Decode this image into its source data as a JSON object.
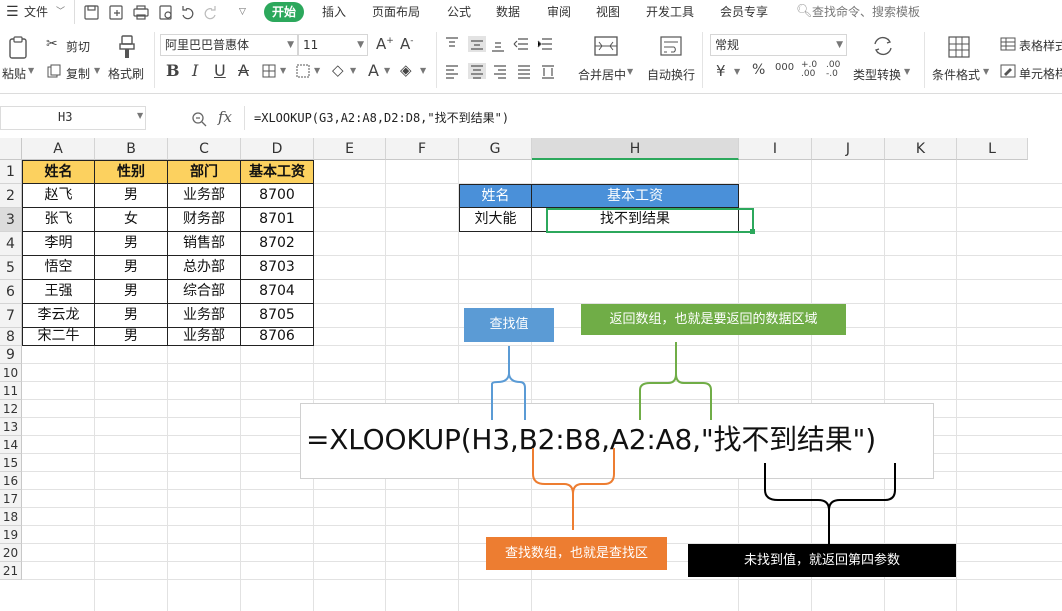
{
  "menubar": {
    "file_label": "文件",
    "tabs": [
      "开始",
      "插入",
      "页面布局",
      "公式",
      "数据",
      "审阅",
      "视图",
      "开发工具",
      "会员专享"
    ],
    "search_placeholder": "查找命令、搜索模板"
  },
  "ribbon": {
    "paste_label": "粘贴",
    "cut_label": "剪切",
    "copy_label": "复制",
    "format_painter_label": "格式刷",
    "font_name": "阿里巴巴普惠体",
    "font_size": "11",
    "merge_label": "合并居中",
    "wrap_label": "自动换行",
    "number_format": "常规",
    "type_convert_label": "类型转换",
    "cond_format_label": "条件格式",
    "table_style_label": "表格样式",
    "cell_style_label": "单元格样"
  },
  "formula_bar": {
    "name_box": "H3",
    "fx_label": "fx",
    "formula": "=XLOOKUP(G3,A2:A8,D2:D8,\"找不到结果\")"
  },
  "columns": [
    "A",
    "B",
    "C",
    "D",
    "E",
    "F",
    "G",
    "H",
    "I",
    "J",
    "K",
    "L"
  ],
  "rows": [
    "1",
    "2",
    "3",
    "4",
    "5",
    "6",
    "7",
    "8",
    "9",
    "10",
    "11",
    "12",
    "13",
    "14",
    "15",
    "16",
    "17",
    "18",
    "19",
    "20",
    "21"
  ],
  "table": {
    "headers": [
      "姓名",
      "性别",
      "部门",
      "基本工资"
    ],
    "rows": [
      [
        "赵飞",
        "男",
        "业务部",
        "8700"
      ],
      [
        "张飞",
        "女",
        "财务部",
        "8701"
      ],
      [
        "李明",
        "男",
        "销售部",
        "8702"
      ],
      [
        "悟空",
        "男",
        "总办部",
        "8703"
      ],
      [
        "王强",
        "男",
        "综合部",
        "8704"
      ],
      [
        "李云龙",
        "男",
        "业务部",
        "8705"
      ],
      [
        "宋二牛",
        "男",
        "业务部",
        "8706"
      ]
    ]
  },
  "lookup": {
    "headers": [
      "姓名",
      "基本工资"
    ],
    "name": "刘大能",
    "result": "找不到结果"
  },
  "annotation": {
    "formula": "=XLOOKUP(H3,B2:B8,A2:A8,\"找不到结果\")",
    "lookup_value": "查找值",
    "return_array": "返回数组，也就是要返回的数据区域",
    "lookup_array": "查找数组，也就是查找区",
    "not_found": "未找到值，就返回第四参数"
  },
  "colors": {
    "accent": "#2ca85c",
    "header_yellow": "#fcd15f",
    "header_blue": "#4a90d9",
    "callout_blue": "#5b9bd5",
    "callout_green": "#70ad47",
    "callout_orange": "#ed7d31",
    "callout_black": "#000000"
  }
}
